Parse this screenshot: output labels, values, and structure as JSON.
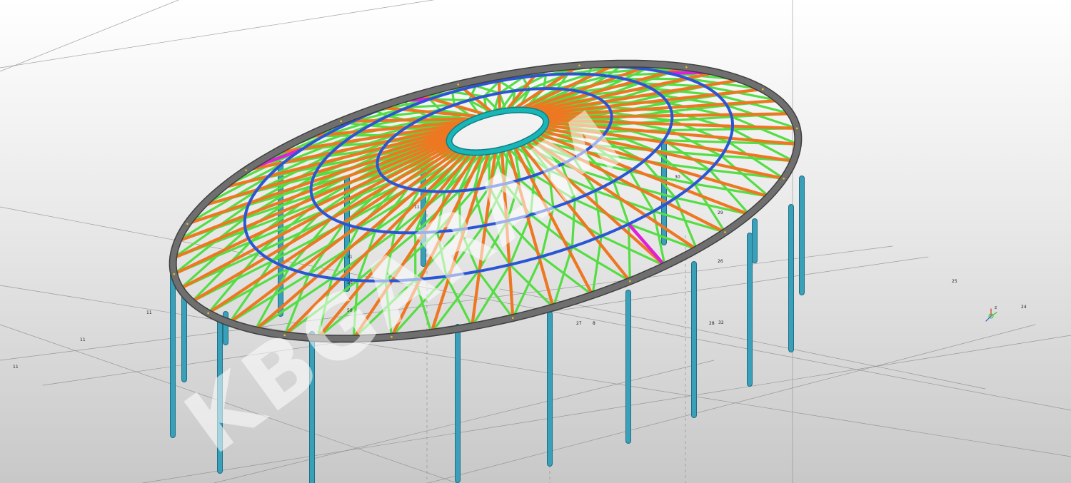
{
  "watermark": {
    "text": "KBGARAM"
  },
  "colors": {
    "background_top": "#ffffff",
    "background_bottom": "#c8c8c8",
    "ring_beam": "#6f6f70",
    "column": "#3a9fb8",
    "radial_rib": "#ee7722",
    "diagonal_brace": "#55dd44",
    "hoop_ring": "#2a56d6",
    "bracing_highlight": "#e020d8",
    "compression_ring": "#19b6b8",
    "grid_line": "#8a8a8a"
  },
  "grid_labels": [
    "11",
    "11",
    "11",
    "11",
    "24",
    "25",
    "26",
    "27",
    "28",
    "29",
    "30",
    "31",
    "32",
    "50",
    "50",
    "8"
  ],
  "axis_gizmo": {
    "z_label": "z",
    "y_label": "y",
    "x_label": "x"
  },
  "structure": {
    "columns": 22,
    "radial_ribs": 48,
    "hoop_rings": 4
  }
}
